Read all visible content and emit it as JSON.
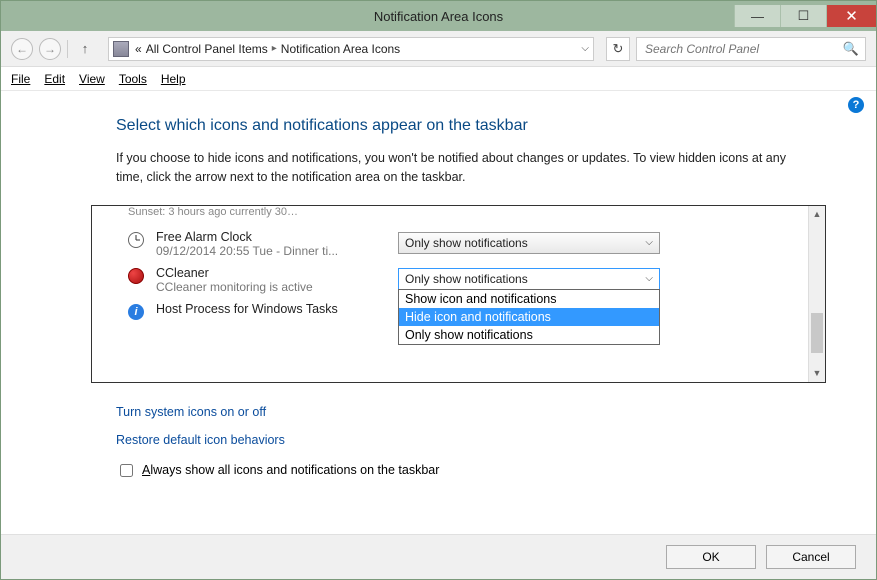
{
  "window": {
    "title": "Notification Area Icons"
  },
  "nav": {
    "breadcrumb_prefix": "«",
    "crumb1": "All Control Panel Items",
    "crumb2": "Notification Area Icons",
    "search_placeholder": "Search Control Panel"
  },
  "menu": {
    "file": "File",
    "edit": "Edit",
    "view": "View",
    "tools": "Tools",
    "help": "Help"
  },
  "page": {
    "heading": "Select which icons and notifications appear on the taskbar",
    "description": "If you choose to hide icons and notifications, you won't be notified about changes or updates. To view hidden icons at any time, click the arrow next to the notification area on the taskbar.",
    "truncated": "Sunset: 3 hours ago  currently 30…"
  },
  "rows": [
    {
      "title": "Free Alarm Clock",
      "sub": "09/12/2014 20:55 Tue - Dinner ti...",
      "value": "Only show notifications"
    },
    {
      "title": "CCleaner",
      "sub": "CCleaner monitoring is active",
      "value": "Only show notifications"
    },
    {
      "title": "Host Process for Windows Tasks",
      "sub": "",
      "value": ""
    }
  ],
  "dropdown": {
    "opt1": "Show icon and notifications",
    "opt2": "Hide icon and notifications",
    "opt3": "Only show notifications"
  },
  "links": {
    "l1": "Turn system icons on or off",
    "l2": "Restore default icon behaviors"
  },
  "checkbox": {
    "label": "Always show all icons and notifications on the taskbar"
  },
  "buttons": {
    "ok": "OK",
    "cancel": "Cancel"
  }
}
